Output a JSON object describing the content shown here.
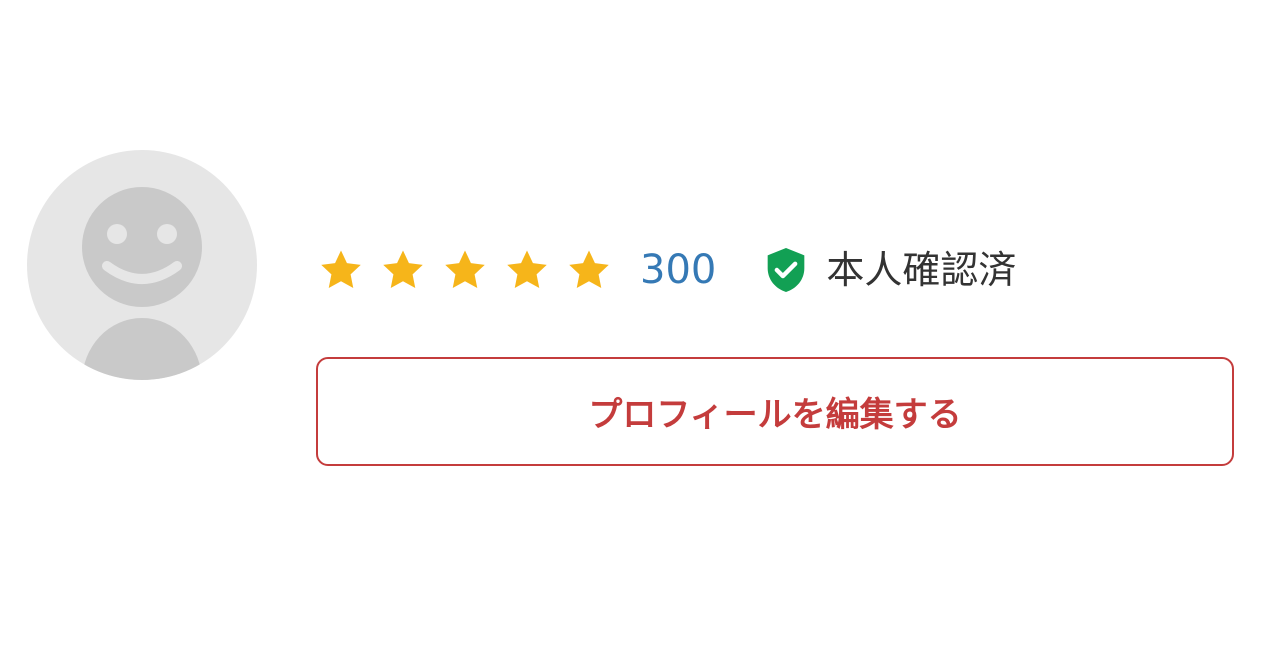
{
  "profile": {
    "avatar_icon": "default-user-avatar-icon",
    "rating": {
      "stars": 5,
      "max_stars": 5,
      "count": "300",
      "star_icon": "star-icon",
      "star_color": "#f6b51a"
    },
    "verification": {
      "icon": "shield-check-icon",
      "icon_color": "#12a054",
      "label": "本人確認済"
    },
    "edit_button": {
      "label": "プロフィールを編集する",
      "color": "#c43c3c"
    }
  }
}
